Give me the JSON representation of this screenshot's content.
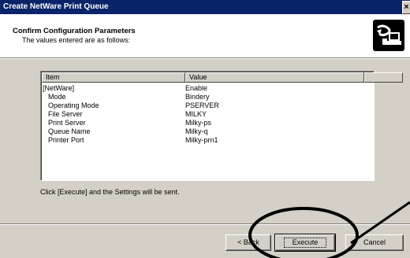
{
  "window": {
    "title": "Create NetWare Print Queue",
    "close_glyph": "×"
  },
  "header": {
    "title": "Confirm Configuration Parameters",
    "subtitle": "The values entered are as follows:",
    "icon": "printer-network-icon"
  },
  "table": {
    "columns": [
      "Item",
      "Value"
    ],
    "rows": [
      {
        "item": "[NetWare]",
        "value": "Enable",
        "indent": false
      },
      {
        "item": "Mode",
        "value": "Bindery",
        "indent": true
      },
      {
        "item": "Operating Mode",
        "value": "PSERVER",
        "indent": true
      },
      {
        "item": "File Server",
        "value": "MILKY",
        "indent": true
      },
      {
        "item": "Print Server",
        "value": "Milky-ps",
        "indent": true
      },
      {
        "item": "Queue Name",
        "value": "Milky-q",
        "indent": true
      },
      {
        "item": "Printer Port",
        "value": "Milky-prn1",
        "indent": true
      }
    ]
  },
  "info_text": "Click [Execute] and the Settings will be sent.",
  "buttons": {
    "back": "< Back",
    "execute": "Execute",
    "cancel": "Cancel"
  },
  "colors": {
    "titlebar": "#0a246a",
    "dialog": "#d4d0c8",
    "annotation": "#000000"
  }
}
